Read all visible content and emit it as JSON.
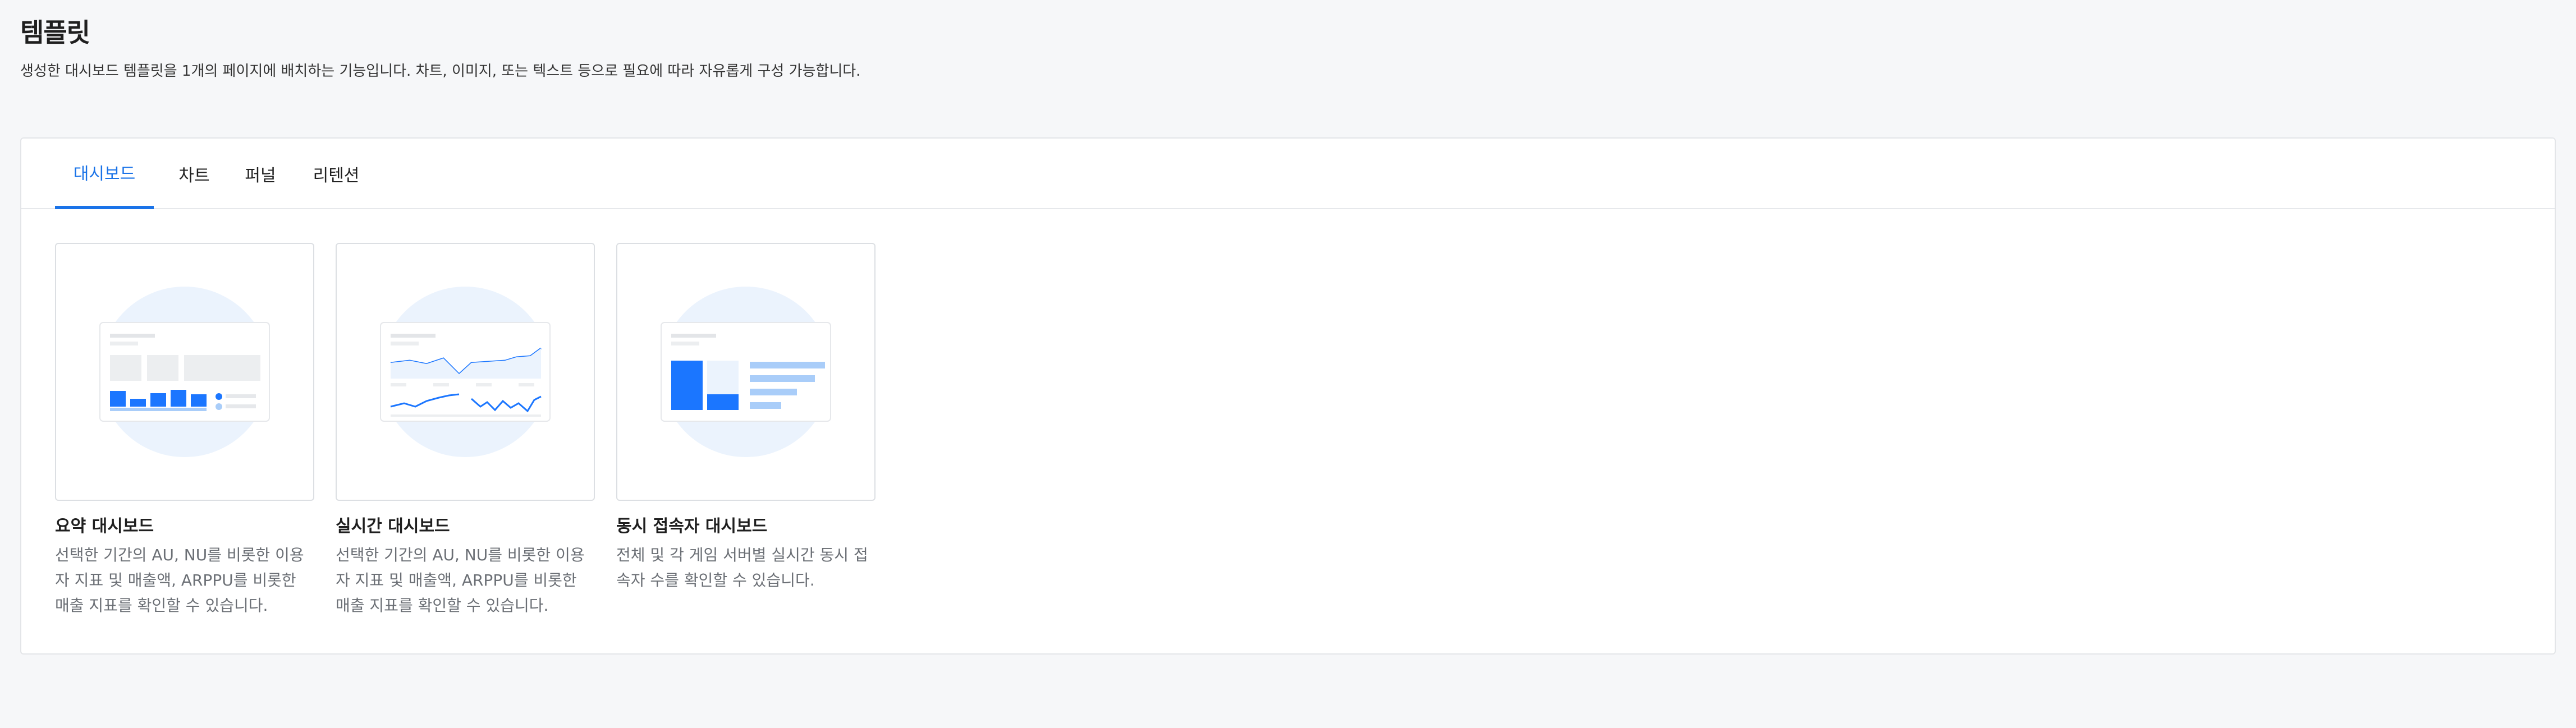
{
  "header": {
    "title": "템플릿",
    "description": "생성한 대시보드 템플릿을 1개의 페이지에 배치하는 기능입니다. 차트, 이미지, 또는 텍스트 등으로 필요에 따라 자유롭게 구성 가능합니다."
  },
  "tabs": [
    {
      "label": "대시보드",
      "active": true
    },
    {
      "label": "차트",
      "active": false
    },
    {
      "label": "퍼널",
      "active": false
    },
    {
      "label": "리텐션",
      "active": false
    }
  ],
  "templates": [
    {
      "title": "요약 대시보드",
      "description": "선택한 기간의 AU, NU를 비롯한 이용자 지표 및 매출액, ARPPU를 비롯한 매출 지표를 확인할 수 있습니다.",
      "icon": "summary-dashboard-thumbnail"
    },
    {
      "title": "실시간 대시보드",
      "description": "선택한 기간의 AU, NU를 비롯한 이용자 지표 및 매출액, ARPPU를 비롯한 매출 지표를 확인할 수 있습니다.",
      "icon": "realtime-dashboard-thumbnail"
    },
    {
      "title": "동시 접속자 대시보드",
      "description": "전체 및 각 게임 서버별 실시간 동시 접속자 수를 확인할 수 있습니다.",
      "icon": "concurrent-users-dashboard-thumbnail"
    }
  ],
  "colors": {
    "accent": "#1a73e8",
    "bar_primary": "#1b76ff",
    "bar_secondary": "#a9cdf9",
    "circle_bg": "#ebf3fd"
  }
}
